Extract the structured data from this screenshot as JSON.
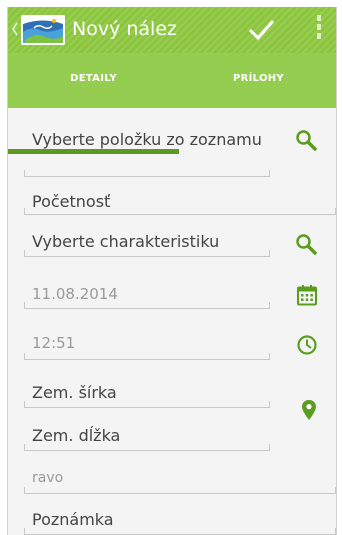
{
  "header": {
    "title": "Nový nález"
  },
  "tabs": [
    {
      "label": "DETAILY",
      "selected": true
    },
    {
      "label": "PRÍLOHY",
      "selected": false
    }
  ],
  "form": {
    "item_placeholder": "Vyberte položku zo zoznamu",
    "count_placeholder": "Početnosť",
    "characteristic_placeholder": "Vyberte charakteristiku",
    "date_value": "11.08.2014",
    "time_value": "12:51",
    "latitude_placeholder": "Zem. šírka",
    "longitude_placeholder": "Zem. dĺžka",
    "location_value": "ravo",
    "note_placeholder": "Poznámka"
  },
  "colors": {
    "action_bar": "#8cc63f",
    "tabs": "#95cd50",
    "tab_indicator": "#5f9723",
    "icon_green": "#5b9e1f"
  },
  "icons": [
    "search-icon",
    "calendar-icon",
    "clock-icon",
    "location-pin-icon",
    "checkmark-icon",
    "overflow-menu-icon",
    "app-logo"
  ]
}
